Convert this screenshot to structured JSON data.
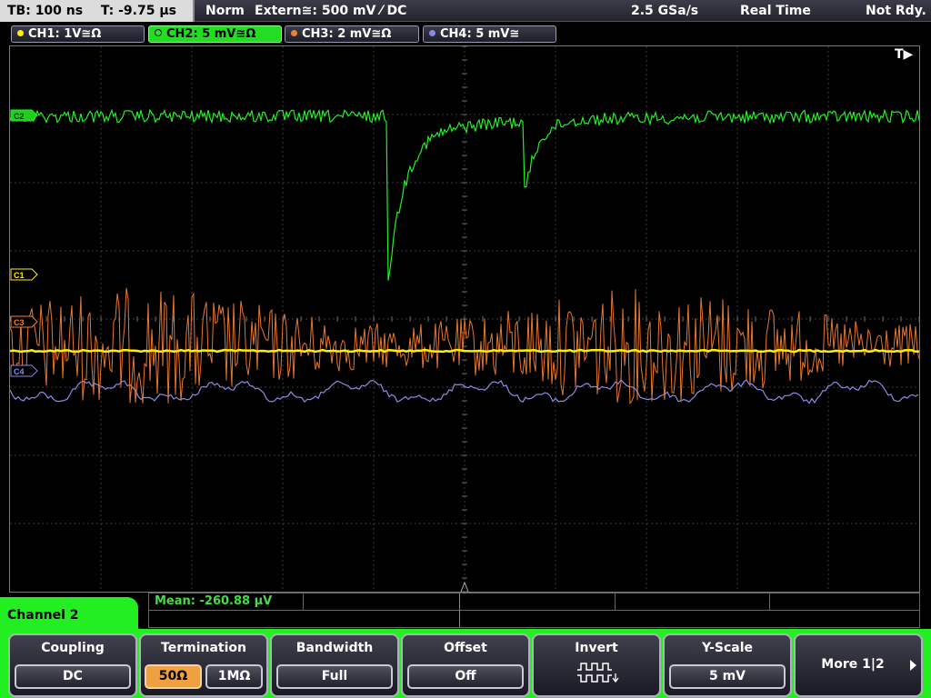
{
  "topbar": {
    "timebase": "TB: 100 ns",
    "trigger_time": "T: -9.75 µs",
    "mode": "Norm",
    "trigger_source": "Extern≅: 500 mV ⁄ DC",
    "sample_rate": "2.5 GSa/s",
    "acq_mode": "Real Time",
    "status": "Not Rdy."
  },
  "channels": [
    {
      "label": "CH1: 1V≅Ω",
      "color": "#ffee00"
    },
    {
      "label": "CH2: 5 mV≅Ω",
      "color": "#22ee22"
    },
    {
      "label": "CH3: 2 mV≅Ω",
      "color": "#f08030"
    },
    {
      "label": "CH4: 5 mV≅",
      "color": "#8a8ae6"
    }
  ],
  "markers": {
    "c1": "C1",
    "c2": "C2",
    "c3": "C3",
    "c4": "C4",
    "trigger": "T▶"
  },
  "measurement": {
    "label": "Mean: -260.88 µV"
  },
  "panel": {
    "title": "Channel 2"
  },
  "softkeys": {
    "coupling": {
      "label": "Coupling",
      "value": "DC"
    },
    "termination": {
      "label": "Termination",
      "opt1": "50Ω",
      "opt2": "1MΩ",
      "selected": "50Ω"
    },
    "bandwidth": {
      "label": "Bandwidth",
      "value": "Full"
    },
    "offset": {
      "label": "Offset",
      "value": "Off"
    },
    "invert": {
      "label": "Invert"
    },
    "yscale": {
      "label": "Y-Scale",
      "value": "5 mV"
    },
    "more": {
      "label": "More 1|2"
    }
  }
}
